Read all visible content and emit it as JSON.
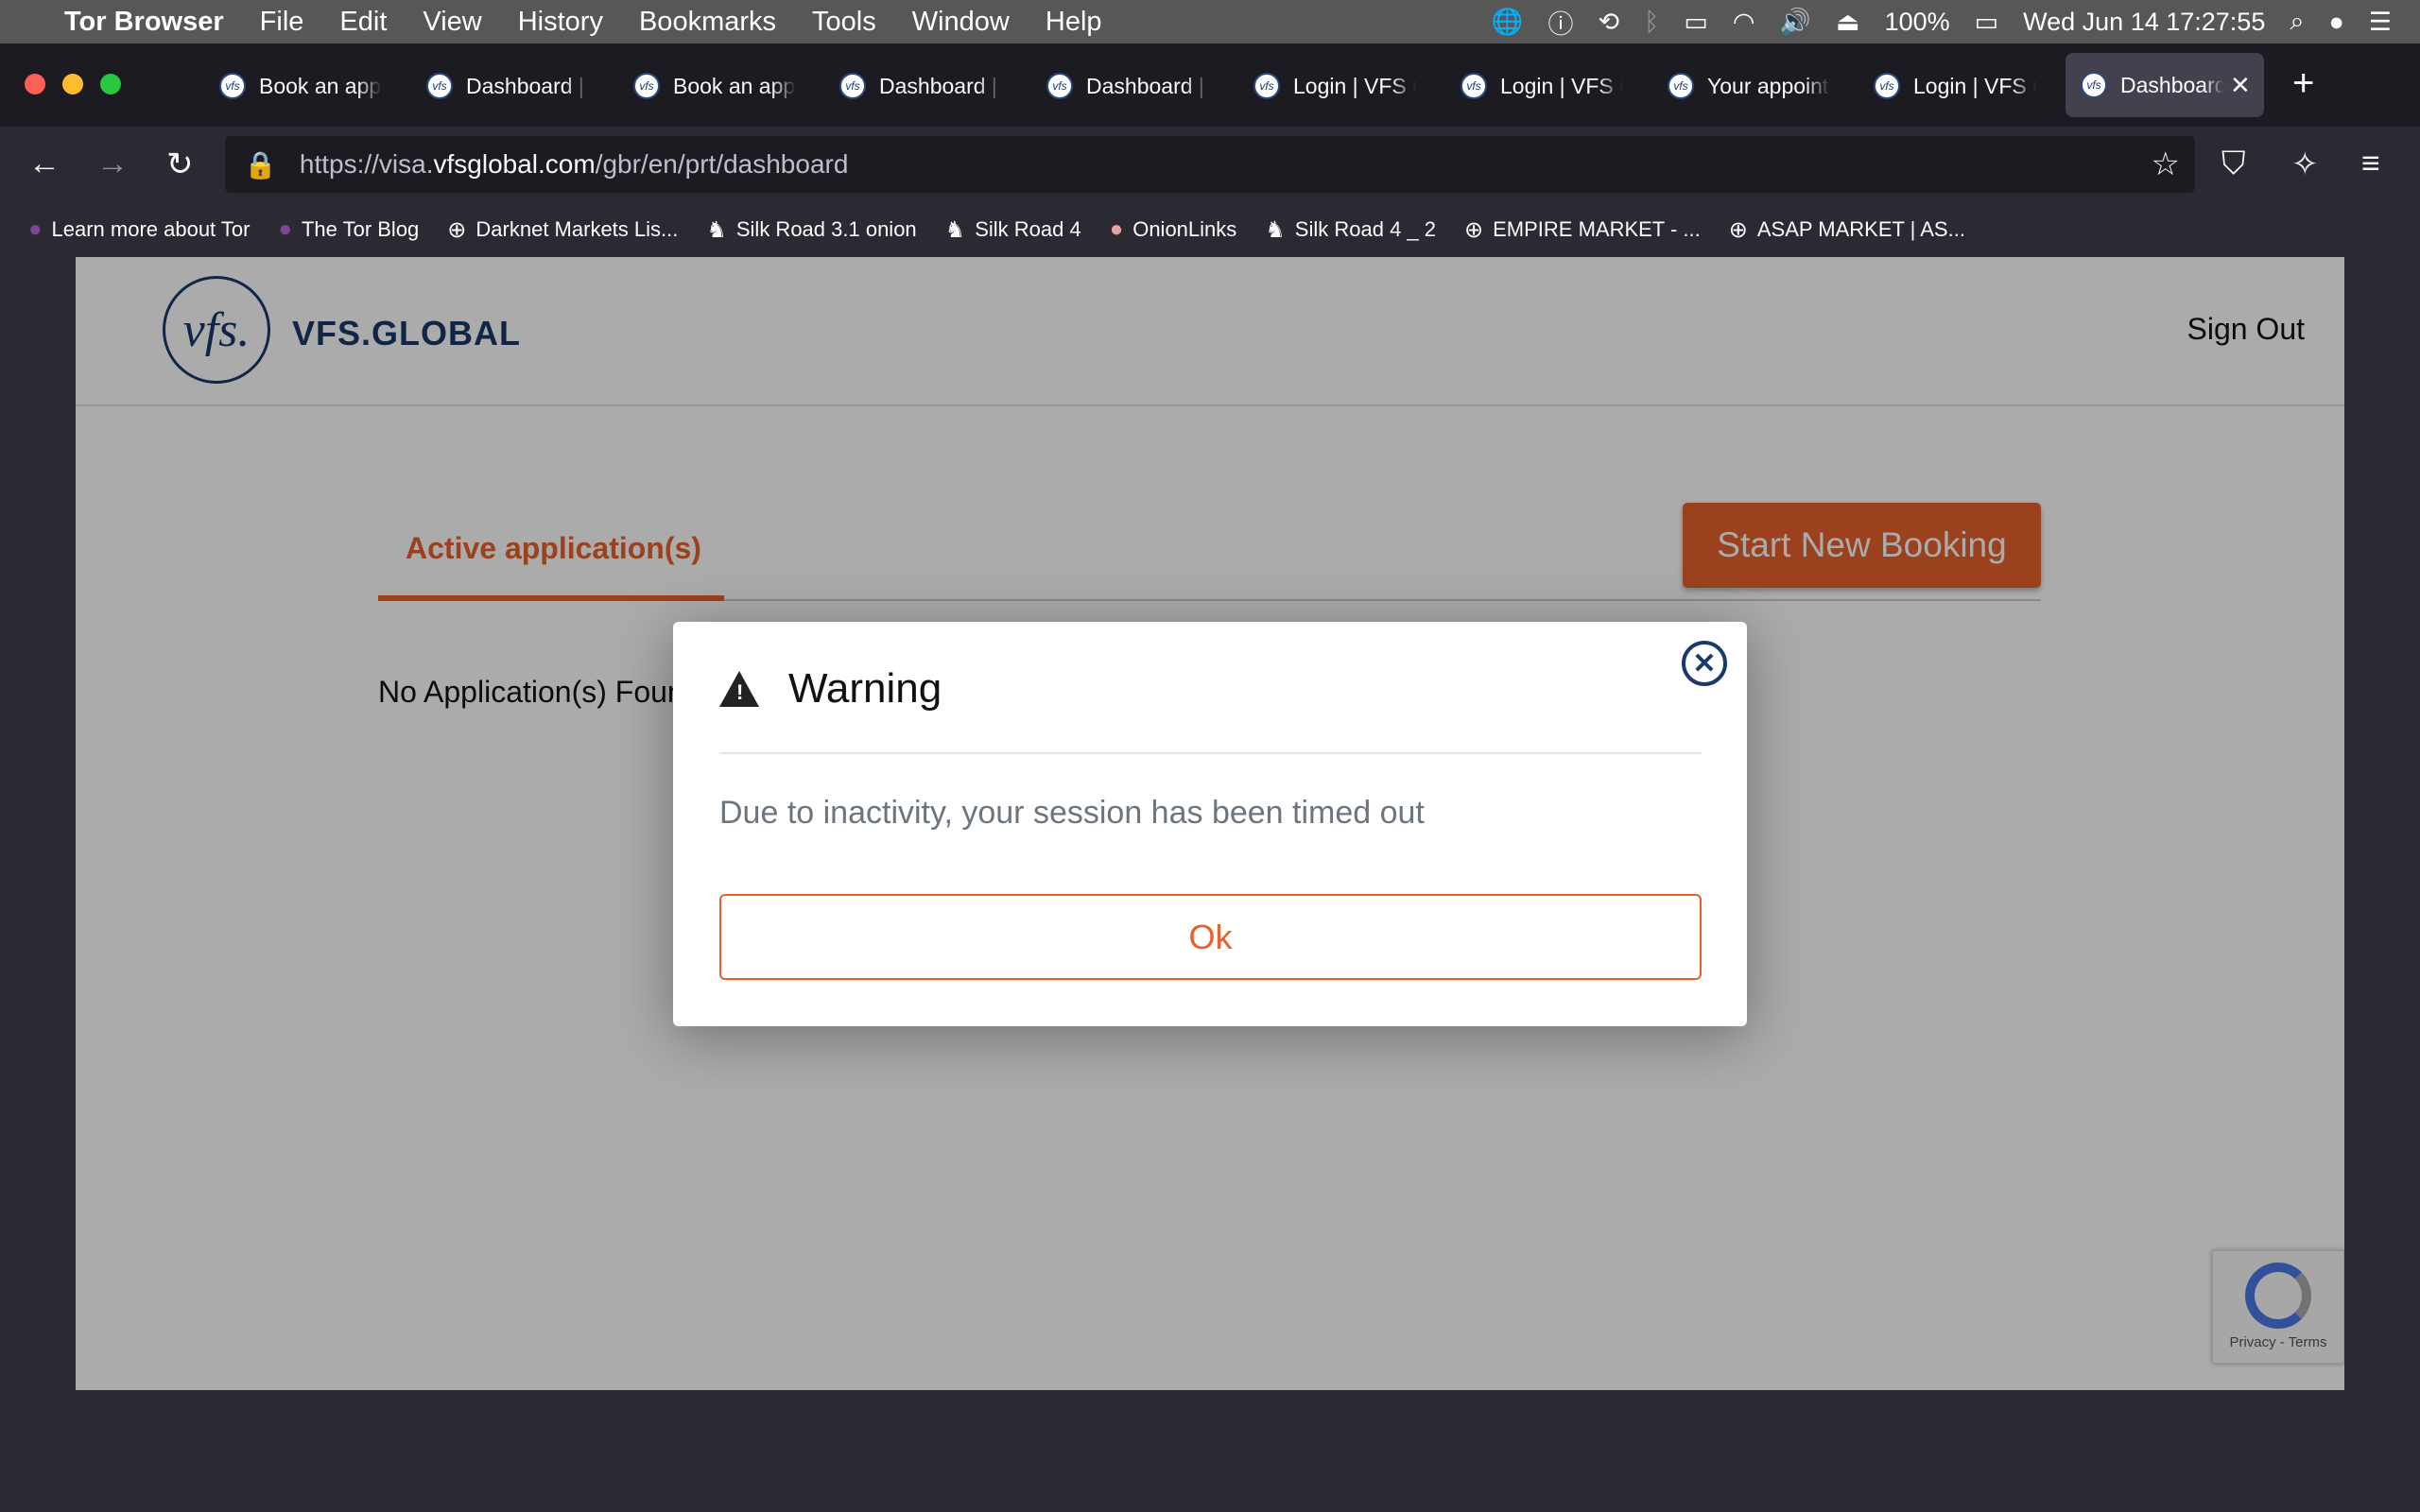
{
  "menubar": {
    "app": "Tor Browser",
    "items": [
      "File",
      "Edit",
      "View",
      "History",
      "Bookmarks",
      "Tools",
      "Window",
      "Help"
    ],
    "battery": "100%",
    "datetime": "Wed Jun 14  17:27:55"
  },
  "tabs": [
    "Book an app",
    "Dashboard |",
    "Book an app",
    "Dashboard |",
    "Dashboard |",
    "Login | VFS G",
    "Login | VFS G",
    "Your appoint",
    "Login | VFS G",
    "Dashboard"
  ],
  "url": {
    "prefix": "https://visa.",
    "host": "vfsglobal.com",
    "path": "/gbr/en/prt/dashboard"
  },
  "bookmarks": [
    "Learn more about Tor",
    "The Tor Blog",
    "Darknet Markets Lis...",
    "Silk Road 3.1 onion",
    "Silk Road 4",
    "OnionLinks",
    "Silk Road 4 _ 2",
    "EMPIRE MARKET - ...",
    "ASAP MARKET | AS..."
  ],
  "site": {
    "logo_text": "vfs.",
    "brand": "VFS.GLOBAL",
    "sign_out": "Sign Out",
    "active_tab": "Active application(s)",
    "start_booking": "Start New Booking",
    "no_apps": "No Application(s) Found"
  },
  "recaptcha": {
    "links": "Privacy - Terms"
  },
  "dialog": {
    "title": "Warning",
    "message": "Due to inactivity, your session has been timed out",
    "ok": "Ok"
  },
  "colors": {
    "accent": "#e8612c",
    "brand": "#1a3a6b"
  }
}
